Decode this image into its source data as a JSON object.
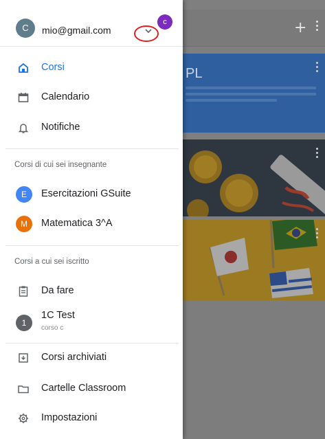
{
  "background": {
    "card1_title": "PL"
  },
  "account": {
    "avatar_letter": "C",
    "email": "mio@gmail.com",
    "secondary_avatar_letter": "c"
  },
  "nav": {
    "corsi": "Corsi",
    "calendario": "Calendario",
    "notifiche": "Notifiche"
  },
  "teaching": {
    "header": "Corsi di cui sei insegnante",
    "courses": [
      {
        "letter": "E",
        "name": "Esercitazioni GSuite",
        "color": "#4285f4"
      },
      {
        "letter": "M",
        "name": "Matematica 3^A",
        "color": "#e8710a"
      }
    ]
  },
  "enrolled": {
    "header": "Corsi a cui sei iscritto",
    "todo": "Da fare",
    "course": {
      "letter": "1",
      "name": "1C Test",
      "section": "corso c",
      "color": "#5f6368"
    }
  },
  "footer": {
    "archived": "Corsi archiviati",
    "folders": "Cartelle Classroom",
    "settings": "Impostazioni"
  },
  "colors": {
    "accent": "#1a73e8",
    "annotation_ring": "#e02020",
    "secondary_avatar": "#7b2bbf"
  }
}
